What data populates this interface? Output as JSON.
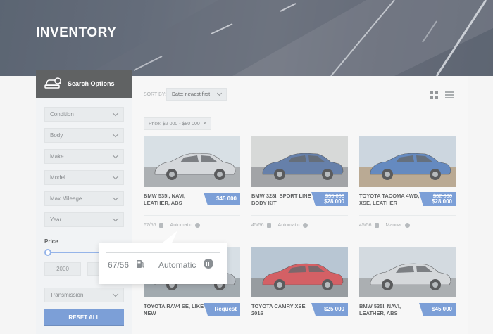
{
  "hero": {
    "title": "INVENTORY"
  },
  "sidebar": {
    "header_label": "Search Options",
    "filters": [
      {
        "label": "Condition"
      },
      {
        "label": "Body"
      },
      {
        "label": "Make"
      },
      {
        "label": "Model"
      },
      {
        "label": "Max Mileage"
      },
      {
        "label": "Year"
      }
    ],
    "price_label": "Price",
    "price_min": "2000",
    "transmission_label": "Transmission",
    "reset_label": "RESET ALL"
  },
  "toolbar": {
    "sort_label": "SORT BY:",
    "sort_value": "Date: newest first"
  },
  "active_filter": {
    "label": "Price: $2 000 - $80 000",
    "remove": "×"
  },
  "listings": [
    {
      "title": "BMW 535I, NAVI, LEATHER, ABS",
      "price": "$45 000",
      "old_price": "",
      "mpg": "67/56",
      "transmission": "Automatic",
      "car_color": "#c5c9ce"
    },
    {
      "title": "BMW 328I, SPORT LINE BODY KIT",
      "price": "$28 000",
      "old_price": "$35 000",
      "mpg": "45/56",
      "transmission": "Automatic",
      "car_color": "#2b4f8a"
    },
    {
      "title": "TOYOTA TACOMA 4WD, XSE, LEATHER",
      "price": "$28 000",
      "old_price": "$32 000",
      "mpg": "45/56",
      "transmission": "Manual",
      "car_color": "#2a5ea8"
    },
    {
      "title": "TOYOTA RAV4 SE, LIKE NEW",
      "price": "Request",
      "old_price": "",
      "mpg": "",
      "transmission": "",
      "car_color": "#9aa3ab"
    },
    {
      "title": "TOYOTA CAMRY XSE 2016",
      "price": "$25 000",
      "old_price": "",
      "mpg": "",
      "transmission": "",
      "car_color": "#c4232a"
    },
    {
      "title": "BMW 535I, NAVI, LEATHER, ABS",
      "price": "$45 000",
      "old_price": "",
      "mpg": "",
      "transmission": "",
      "car_color": "#c5c9ce"
    }
  ],
  "tooltip": {
    "mpg": "67/56",
    "transmission": "Automatic"
  },
  "colors": {
    "accent": "#4a7bc8",
    "dark": "#232628"
  }
}
